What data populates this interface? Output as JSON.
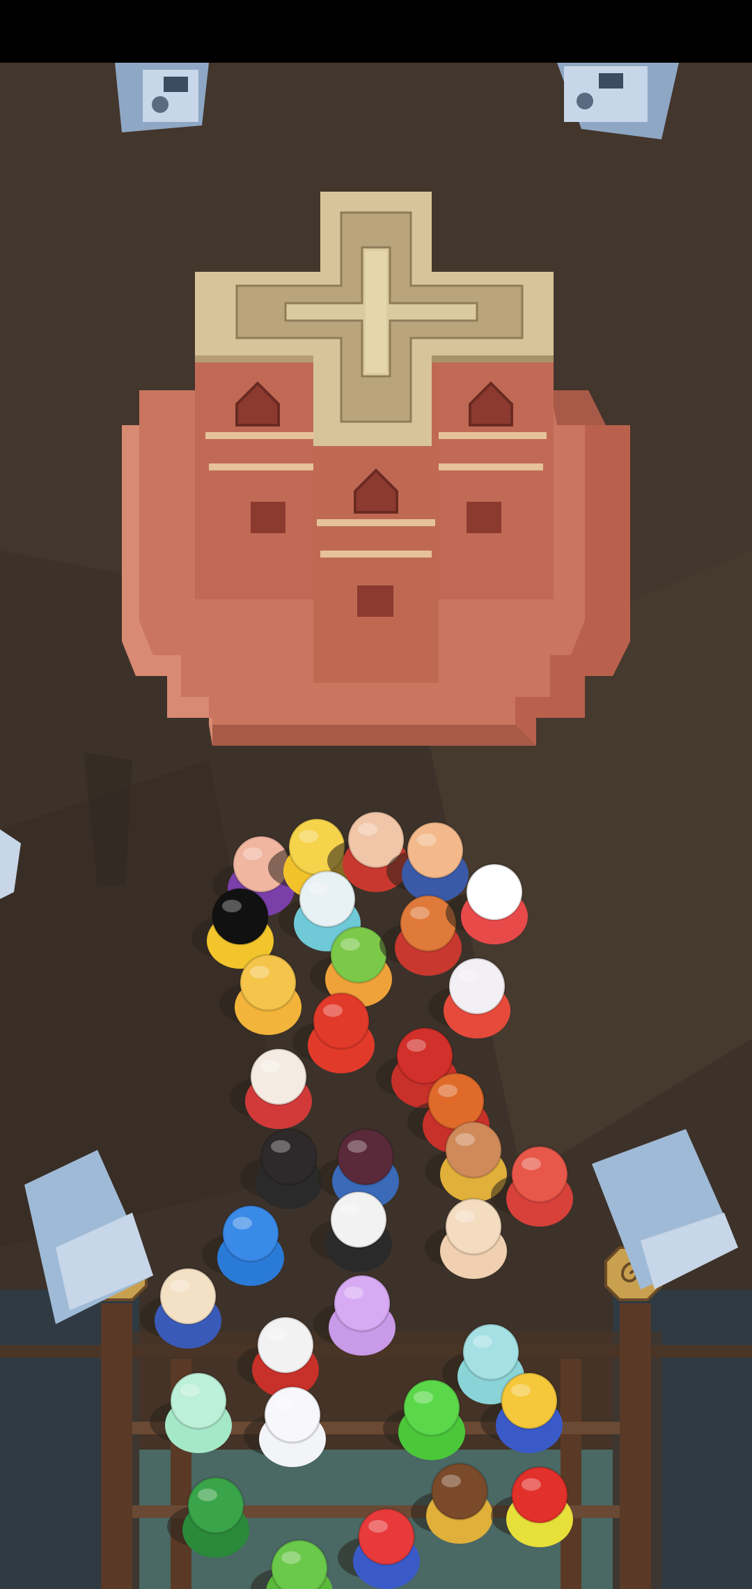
{
  "screen": {
    "status_bar": "",
    "scene": "church-courtyard"
  },
  "colors": {
    "ground": "#3d3229",
    "ground_light": "#4a3d32",
    "church_wall": "#c97560",
    "church_shadow": "#a85a48",
    "roof": "#d8c49a",
    "roof_dark": "#b9a47c",
    "water": "#4bb6c2",
    "bridge": "#5a3a26",
    "machine": "#9fbad6"
  },
  "icons": {
    "atm_left": "atm-machine-icon",
    "atm_right": "atm-machine-icon",
    "spiral_left": "spiral-post-icon",
    "spiral_right": "spiral-post-icon"
  },
  "crowd": {
    "characters": [
      {
        "name": "purple-wizard",
        "color": "#7a3fa8",
        "head": "#f1b6a0"
      },
      {
        "name": "yellow-chick",
        "color": "#f2c22a",
        "head": "#f5d34b"
      },
      {
        "name": "red-cap-hero",
        "color": "#c8382e",
        "head": "#f1c6a8"
      },
      {
        "name": "armored-warrior",
        "color": "#3a5aa8",
        "head": "#f3b98a"
      },
      {
        "name": "cyan-robot",
        "color": "#6fc9d6",
        "head": "#e8f1f4"
      },
      {
        "name": "black-hair-kid",
        "color": "#f1c52b",
        "head": "#111111"
      },
      {
        "name": "green-hair-kid",
        "color": "#f0a23a",
        "head": "#7cc94a"
      },
      {
        "name": "red-armor",
        "color": "#c8382e",
        "head": "#e07a3a"
      },
      {
        "name": "white-bird",
        "color": "#e84a4a",
        "head": "#ffffff"
      },
      {
        "name": "orange-fox",
        "color": "#f2b43a",
        "head": "#f5c54b"
      },
      {
        "name": "white-mouse",
        "color": "#e64a3a",
        "head": "#f2f0f4"
      },
      {
        "name": "red-figure",
        "color": "#e23a2a",
        "head": "#e23a2a"
      },
      {
        "name": "white-hair-elder",
        "color": "#d23a3a",
        "head": "#f4ece2"
      },
      {
        "name": "red-helmet",
        "color": "#c8302a",
        "head": "#d2302a"
      },
      {
        "name": "orange-head",
        "color": "#c8302a",
        "head": "#e06a2a"
      },
      {
        "name": "black-octagon",
        "color": "#2a2a2a",
        "head": "#2e2a2c"
      },
      {
        "name": "purple-octagon",
        "color": "#3a6ab8",
        "head": "#5a2a3a"
      },
      {
        "name": "gold-knight",
        "color": "#e0b03a",
        "head": "#d08a5a"
      },
      {
        "name": "red-lantern",
        "color": "#d8403a",
        "head": "#e8584a"
      },
      {
        "name": "blue-bird",
        "color": "#2a7ad8",
        "head": "#3a8ae8"
      },
      {
        "name": "panda-kid",
        "color": "#2a2a2a",
        "head": "#f2f2f2"
      },
      {
        "name": "beige-bear",
        "color": "#f0d0b0",
        "head": "#f4dcc0"
      },
      {
        "name": "checkered-kid",
        "color": "#3a5ab8",
        "head": "#f4e0c4"
      },
      {
        "name": "pink-bunny",
        "color": "#c89ae8",
        "head": "#d8aaf4"
      },
      {
        "name": "red-masked",
        "color": "#c8302a",
        "head": "#f2f2f2"
      },
      {
        "name": "teal-blob",
        "color": "#8ad4d8",
        "head": "#a4e0e4"
      },
      {
        "name": "mint-blob",
        "color": "#a4e8c8",
        "head": "#bcf0d8"
      },
      {
        "name": "white-ghost",
        "color": "#f2f4f8",
        "head": "#f8f8fc"
      },
      {
        "name": "green-turtle",
        "color": "#2a8a3a",
        "head": "#3aa44a"
      },
      {
        "name": "green-parrot",
        "color": "#4ac83a",
        "head": "#5ad84a"
      },
      {
        "name": "yellow-hair",
        "color": "#3a5ac8",
        "head": "#f4c83a"
      },
      {
        "name": "green-frog",
        "color": "#5ab83a",
        "head": "#6ac84a"
      },
      {
        "name": "brown-kid",
        "color": "#e0b03a",
        "head": "#7a4a2a"
      },
      {
        "name": "clown",
        "color": "#e8e03a",
        "head": "#e2302a"
      },
      {
        "name": "blue-red-hero",
        "color": "#3a5ac8",
        "head": "#e83a3a"
      }
    ]
  }
}
